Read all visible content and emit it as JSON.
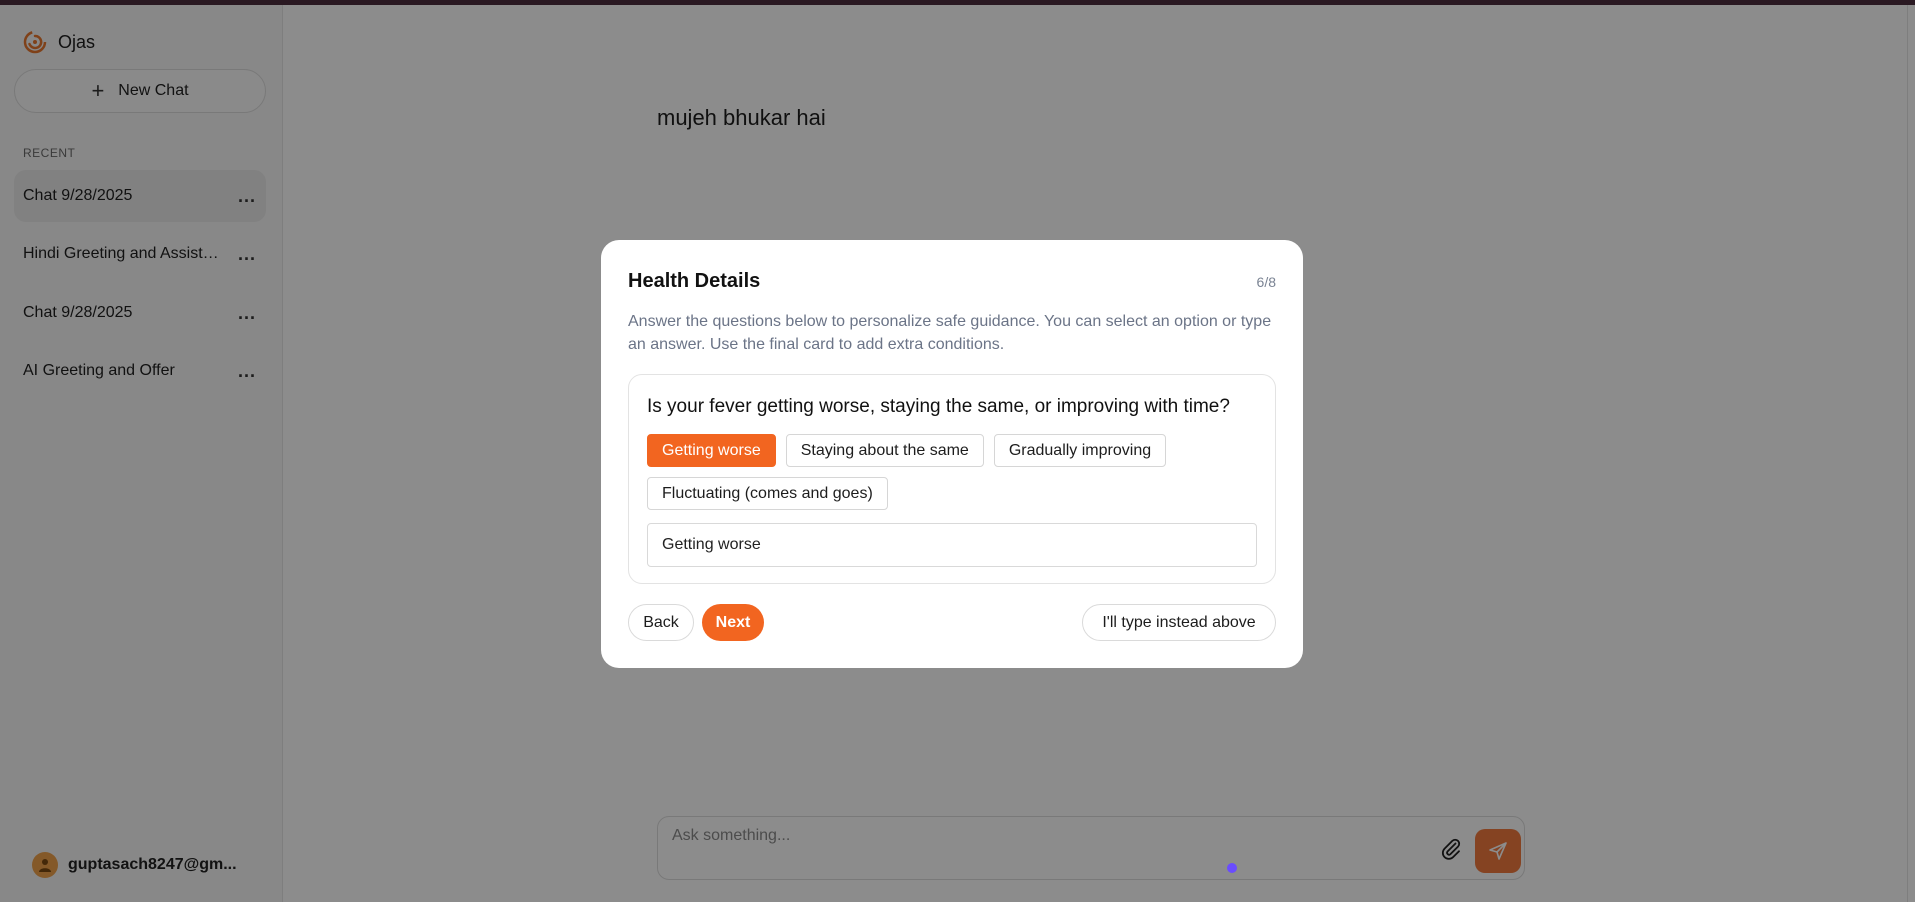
{
  "app": {
    "name": "Ojas",
    "accent": "#f26520"
  },
  "sidebar": {
    "new_chat_label": "New Chat",
    "recent_label": "RECENT",
    "chats": [
      {
        "label": "Chat 9/28/2025",
        "active": true
      },
      {
        "label": "Hindi Greeting and Assistance",
        "active": false
      },
      {
        "label": "Chat 9/28/2025",
        "active": false
      },
      {
        "label": "AI Greeting and Offer",
        "active": false
      }
    ],
    "more_icon": "...",
    "user_email": "guptasach8247@gm..."
  },
  "main": {
    "user_message": "mujeh bhukar hai",
    "composer": {
      "placeholder": "Ask something..."
    }
  },
  "modal": {
    "title": "Health Details",
    "step": "6/8",
    "description": "Answer the questions below to personalize safe guidance. You can select an option or type an answer. Use the final card to add extra conditions.",
    "question": "Is your fever getting worse, staying the same, or improving with time?",
    "options": [
      {
        "label": "Getting worse",
        "selected": true
      },
      {
        "label": "Staying about the same",
        "selected": false
      },
      {
        "label": "Gradually improving",
        "selected": false
      },
      {
        "label": "Fluctuating (comes and goes)",
        "selected": false
      }
    ],
    "answer_value": "Getting worse",
    "back_label": "Back",
    "next_label": "Next",
    "type_instead_label": "I'll type instead above"
  }
}
